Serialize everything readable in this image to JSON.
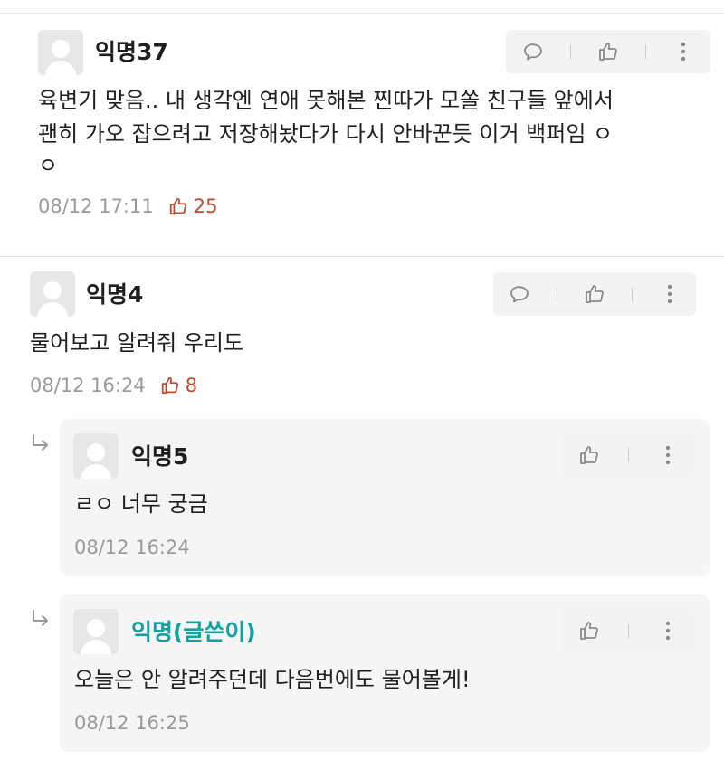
{
  "comments": [
    {
      "author": "익명37",
      "text_line1": "육변기 맞음.. 내 생각엔 연애 못해본 찐따가 모쏠 친구들 앞에서",
      "text_line2": "괜히 가오 잡으려고 저장해놨다가 다시 안바꾼듯 이거 백퍼임 ㅇ",
      "text_line3": "ㅇ",
      "time": "08/12 17:11",
      "likes": "25"
    },
    {
      "author": "익명4",
      "text": "물어보고 알려줘 우리도",
      "time": "08/12 16:24",
      "likes": "8"
    }
  ],
  "replies": [
    {
      "author": "익명5",
      "text": "ㄹㅇ 너무 궁금",
      "time": "08/12 16:24"
    },
    {
      "author": "익명(글쓴이)",
      "text": "오늘은 안 알려주던데 다음번에도 물어볼게!",
      "time": "08/12 16:25"
    }
  ],
  "icons": {
    "comment": "speech-bubble-icon",
    "like": "thumbs-up-icon",
    "more": "vertical-ellipsis-icon",
    "reply": "reply-arrow-icon"
  },
  "colors": {
    "op_author": "#13a0a0",
    "like_count": "#c0472e",
    "meta": "#9a9a9a"
  }
}
